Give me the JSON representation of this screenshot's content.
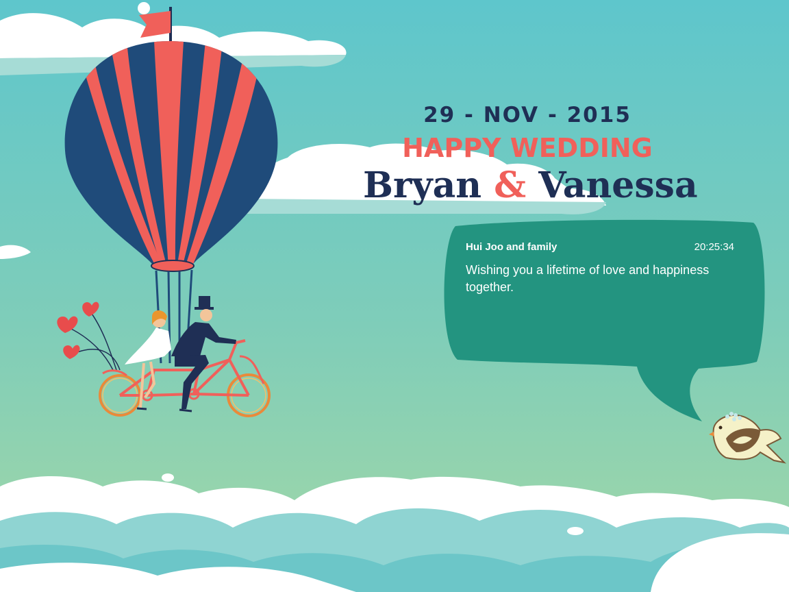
{
  "event": {
    "date": "29 - NOV - 2015",
    "headline": "HAPPY WEDDING",
    "groom": "Bryan",
    "ampersand": "&",
    "bride": "Vanessa"
  },
  "message": {
    "author": "Hui Joo and family",
    "time": "20:25:34",
    "text": "Wishing you a lifetime of love and happiness together."
  },
  "colors": {
    "navy": "#1f2f55",
    "coral": "#f0605a",
    "bubble": "#239480",
    "sky_top": "#5ec6cc",
    "sky_bottom": "#a0d8a8"
  }
}
